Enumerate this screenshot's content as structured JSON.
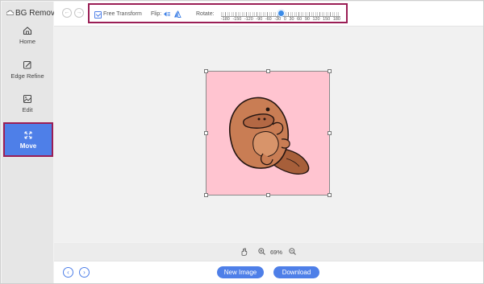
{
  "app": {
    "title": "BG Remover"
  },
  "sidebar": {
    "items": [
      {
        "label": "Home",
        "icon": "home-icon"
      },
      {
        "label": "Edge Refine",
        "icon": "edge-refine-icon"
      },
      {
        "label": "Edit",
        "icon": "edit-image-icon"
      },
      {
        "label": "Move",
        "icon": "move-icon",
        "active": true
      }
    ]
  },
  "toolbar": {
    "free_transform_label": "Free Transform",
    "free_transform_checked": true,
    "flip_label": "Flip:",
    "rotate_label": "Rotate:",
    "rotate_ticks": [
      "-180",
      "-150",
      "-120",
      "-90",
      "-60",
      "-30",
      "0",
      "30",
      "60",
      "90",
      "120",
      "150",
      "180"
    ],
    "rotate_value": 0
  },
  "zoom": {
    "level": "69%"
  },
  "footer": {
    "new_image_label": "New Image",
    "download_label": "Download"
  },
  "colors": {
    "accent": "#4e7fe8",
    "highlight": "#9a1e55",
    "canvas_bg": "#ffc4d0"
  }
}
